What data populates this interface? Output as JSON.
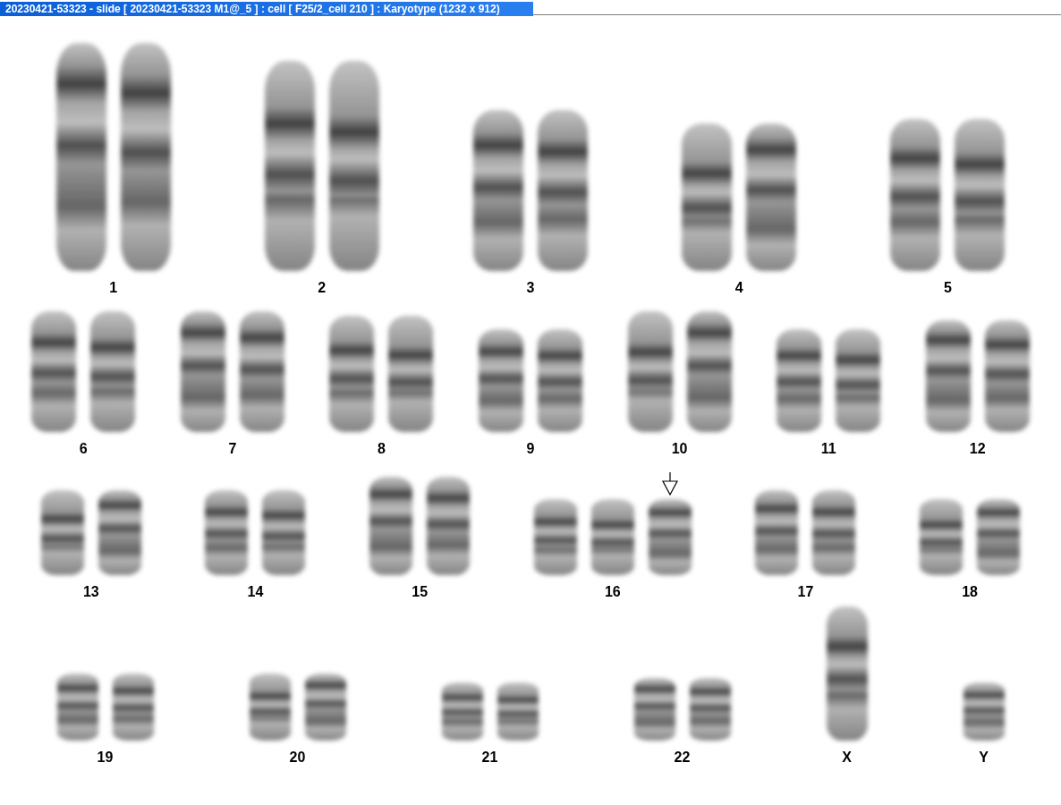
{
  "window": {
    "title": "20230421-53323 - slide [ 20230421-53323 M1@_5 ] : cell [ F25/2_cell 210 ] : Karyotype  (1232 x 912)"
  },
  "karyotype": {
    "rows": [
      {
        "groups": [
          {
            "label": "1",
            "chromosomes": [
              {
                "marked": false
              },
              {
                "marked": false
              }
            ]
          },
          {
            "label": "2",
            "chromosomes": [
              {
                "marked": false
              },
              {
                "marked": false
              }
            ]
          },
          {
            "label": "3",
            "chromosomes": [
              {
                "marked": false
              },
              {
                "marked": false
              }
            ]
          },
          {
            "label": "4",
            "chromosomes": [
              {
                "marked": false
              },
              {
                "marked": false
              }
            ]
          },
          {
            "label": "5",
            "chromosomes": [
              {
                "marked": false
              },
              {
                "marked": false
              }
            ]
          }
        ]
      },
      {
        "groups": [
          {
            "label": "6",
            "chromosomes": [
              {
                "marked": false
              },
              {
                "marked": false
              }
            ]
          },
          {
            "label": "7",
            "chromosomes": [
              {
                "marked": false
              },
              {
                "marked": false
              }
            ]
          },
          {
            "label": "8",
            "chromosomes": [
              {
                "marked": false
              },
              {
                "marked": false
              }
            ]
          },
          {
            "label": "9",
            "chromosomes": [
              {
                "marked": false
              },
              {
                "marked": false
              }
            ]
          },
          {
            "label": "10",
            "chromosomes": [
              {
                "marked": false
              },
              {
                "marked": false
              }
            ]
          },
          {
            "label": "11",
            "chromosomes": [
              {
                "marked": false
              },
              {
                "marked": false
              }
            ]
          },
          {
            "label": "12",
            "chromosomes": [
              {
                "marked": false
              },
              {
                "marked": false
              }
            ]
          }
        ]
      },
      {
        "groups": [
          {
            "label": "13",
            "chromosomes": [
              {
                "marked": false
              },
              {
                "marked": false
              }
            ]
          },
          {
            "label": "14",
            "chromosomes": [
              {
                "marked": false
              },
              {
                "marked": false
              }
            ]
          },
          {
            "label": "15",
            "chromosomes": [
              {
                "marked": false
              },
              {
                "marked": false
              }
            ]
          },
          {
            "label": "16",
            "chromosomes": [
              {
                "marked": false
              },
              {
                "marked": false
              },
              {
                "marked": true
              }
            ]
          },
          {
            "label": "17",
            "chromosomes": [
              {
                "marked": false
              },
              {
                "marked": false
              }
            ]
          },
          {
            "label": "18",
            "chromosomes": [
              {
                "marked": false
              },
              {
                "marked": false
              }
            ]
          }
        ]
      },
      {
        "groups": [
          {
            "label": "19",
            "chromosomes": [
              {
                "marked": false
              },
              {
                "marked": false
              }
            ]
          },
          {
            "label": "20",
            "chromosomes": [
              {
                "marked": false
              },
              {
                "marked": false
              }
            ]
          },
          {
            "label": "21",
            "chromosomes": [
              {
                "marked": false
              },
              {
                "marked": false
              }
            ]
          },
          {
            "label": "22",
            "chromosomes": [
              {
                "marked": false
              },
              {
                "marked": false
              }
            ]
          },
          {
            "label": "X",
            "chromosomes": [
              {
                "marked": false
              }
            ]
          },
          {
            "label": "Y",
            "chromosomes": [
              {
                "marked": false
              }
            ]
          }
        ]
      }
    ]
  }
}
